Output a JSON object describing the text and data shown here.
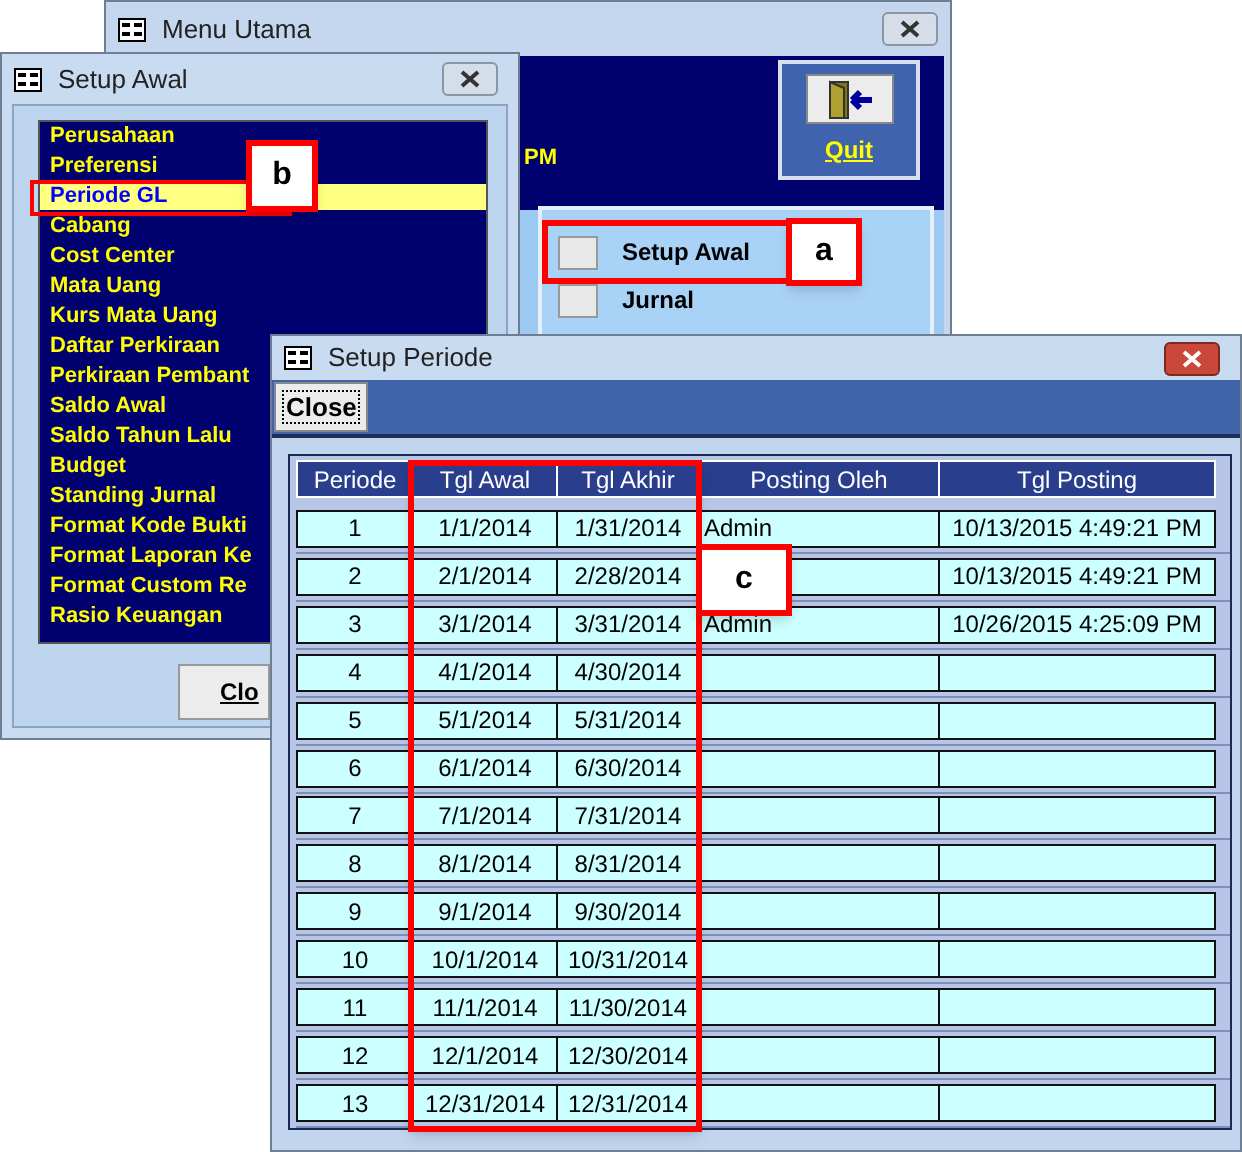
{
  "menu_utama": {
    "title": "Menu Utama",
    "clock_text": "PM",
    "quit_button": "Quit",
    "buttons": [
      {
        "label": "Setup Awal"
      },
      {
        "label": "Jurnal"
      }
    ]
  },
  "setup_awal": {
    "title": "Setup Awal",
    "items": [
      {
        "label": "Perusahaan",
        "selected": false
      },
      {
        "label": "Preferensi",
        "selected": false
      },
      {
        "label": "Periode GL",
        "selected": true
      },
      {
        "label": "Cabang",
        "selected": false
      },
      {
        "label": "Cost Center",
        "selected": false
      },
      {
        "label": "Mata Uang",
        "selected": false
      },
      {
        "label": "Kurs Mata Uang",
        "selected": false
      },
      {
        "label": "Daftar Perkiraan",
        "selected": false
      },
      {
        "label": "Perkiraan Pembant",
        "selected": false
      },
      {
        "label": "Saldo Awal",
        "selected": false
      },
      {
        "label": "Saldo Tahun Lalu",
        "selected": false
      },
      {
        "label": "Budget",
        "selected": false
      },
      {
        "label": "Standing Jurnal",
        "selected": false
      },
      {
        "label": "Format Kode Bukti",
        "selected": false
      },
      {
        "label": "Format Laporan Ke",
        "selected": false
      },
      {
        "label": "Format Custom Re",
        "selected": false
      },
      {
        "label": "Rasio Keuangan",
        "selected": false
      }
    ],
    "close_button": "Clo"
  },
  "setup_periode": {
    "title": "Setup Periode",
    "close_button": "Close",
    "table": {
      "columns": [
        "Periode",
        "Tgl Awal",
        "Tgl Akhir",
        "Posting Oleh",
        "Tgl Posting"
      ],
      "rows": [
        [
          "1",
          "1/1/2014",
          "1/31/2014",
          "Admin",
          "10/13/2015 4:49:21 PM"
        ],
        [
          "2",
          "2/1/2014",
          "2/28/2014",
          "",
          "10/13/2015 4:49:21 PM"
        ],
        [
          "3",
          "3/1/2014",
          "3/31/2014",
          "Admin",
          "10/26/2015 4:25:09 PM"
        ],
        [
          "4",
          "4/1/2014",
          "4/30/2014",
          "",
          ""
        ],
        [
          "5",
          "5/1/2014",
          "5/31/2014",
          "",
          ""
        ],
        [
          "6",
          "6/1/2014",
          "6/30/2014",
          "",
          ""
        ],
        [
          "7",
          "7/1/2014",
          "7/31/2014",
          "",
          ""
        ],
        [
          "8",
          "8/1/2014",
          "8/31/2014",
          "",
          ""
        ],
        [
          "9",
          "9/1/2014",
          "9/30/2014",
          "",
          ""
        ],
        [
          "10",
          "10/1/2014",
          "10/31/2014",
          "",
          ""
        ],
        [
          "11",
          "11/1/2014",
          "11/30/2014",
          "",
          ""
        ],
        [
          "12",
          "12/1/2014",
          "12/30/2014",
          "",
          ""
        ],
        [
          "13",
          "12/31/2014",
          "12/31/2014",
          "",
          ""
        ]
      ]
    }
  },
  "callouts": [
    {
      "label": "a"
    },
    {
      "label": "b"
    },
    {
      "label": "c"
    }
  ]
}
